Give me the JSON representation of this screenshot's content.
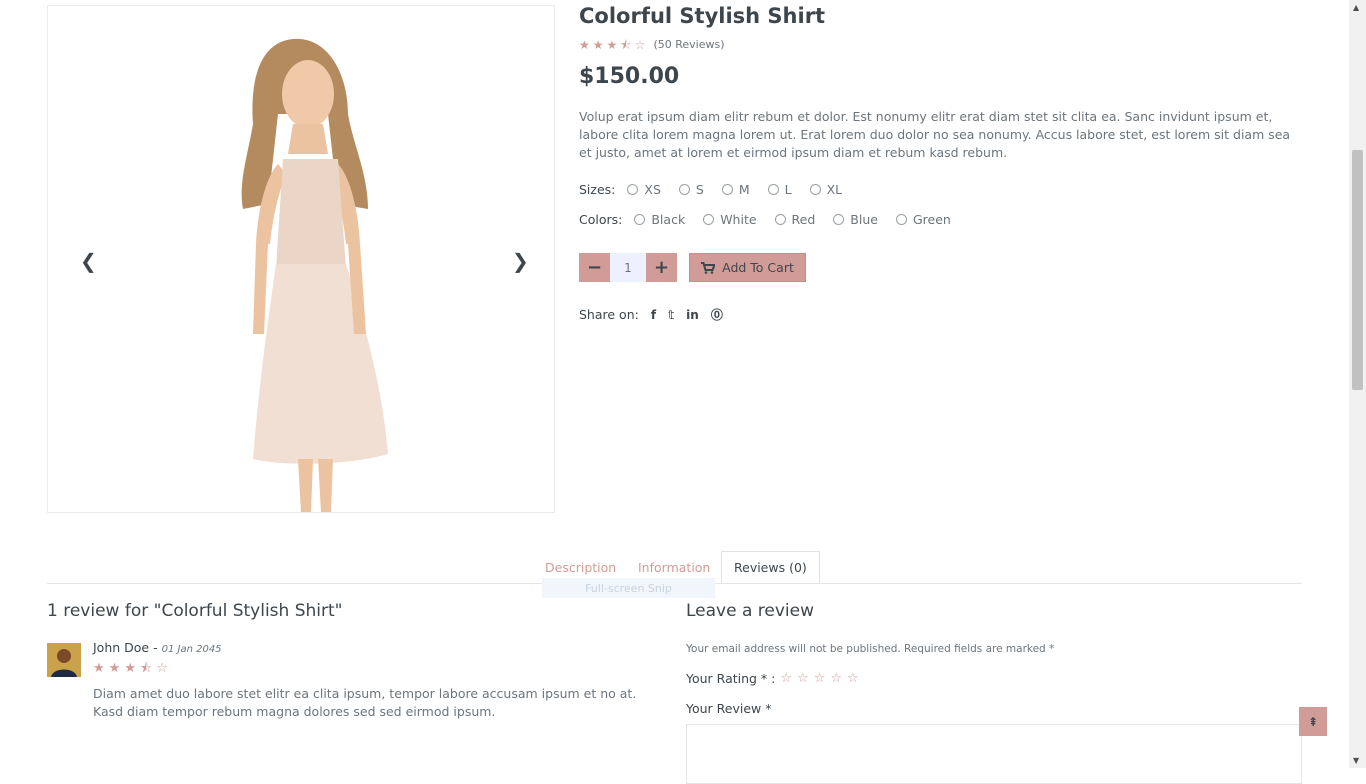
{
  "product": {
    "title": "Colorful Stylish Shirt",
    "rating": 3.5,
    "reviews_count": "(50 Reviews)",
    "price": "$150.00",
    "description": "Volup erat ipsum diam elitr rebum et dolor. Est nonumy elitr erat diam stet sit clita ea. Sanc invidunt ipsum et, labore clita lorem magna lorem ut. Erat lorem duo dolor no sea nonumy. Accus labore stet, est lorem sit diam sea et justo, amet at lorem et eirmod ipsum diam et rebum kasd rebum."
  },
  "sizes": {
    "label": "Sizes:",
    "options": [
      "XS",
      "S",
      "M",
      "L",
      "XL"
    ]
  },
  "colors": {
    "label": "Colors:",
    "options": [
      "Black",
      "White",
      "Red",
      "Blue",
      "Green"
    ]
  },
  "quantity": {
    "value": "1",
    "minus": "−",
    "plus": "+"
  },
  "cart": {
    "label": "Add To Cart"
  },
  "share": {
    "label": "Share on:",
    "icons": [
      "facebook-icon",
      "twitter-icon",
      "linkedin-icon",
      "pinterest-icon"
    ]
  },
  "tabs": [
    "Description",
    "Information",
    "Reviews (0)"
  ],
  "snip_overlay": "Full-screen Snip",
  "reviews": {
    "heading": "1 review for \"Colorful Stylish Shirt\"",
    "items": [
      {
        "name": "John Doe",
        "date": "01 Jan 2045",
        "rating": 3.5,
        "text": "Diam amet duo labore stet elitr ea clita ipsum, tempor labore accusam ipsum et no at. Kasd diam tempor rebum magna dolores sed sed eirmod ipsum."
      }
    ]
  },
  "review_form": {
    "heading": "Leave a review",
    "note": "Your email address will not be published. Required fields are marked *",
    "rating_label": "Your Rating * :",
    "review_label": "Your Review *"
  },
  "colors_theme": {
    "accent": "#d19c97",
    "dark": "#3d464d",
    "muted": "#6c757d"
  }
}
